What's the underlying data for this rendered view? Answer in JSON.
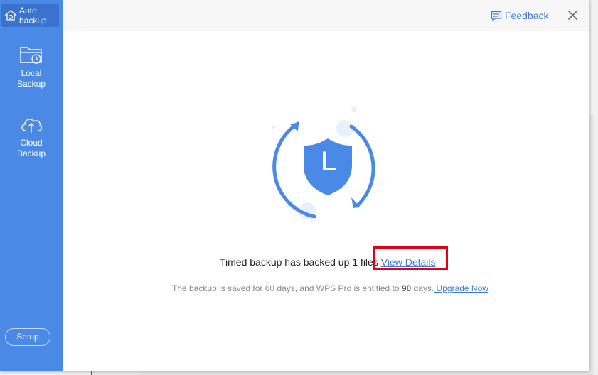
{
  "sidebar": {
    "active_item": {
      "label_line1": "Auto",
      "label_line2": "backup",
      "icon": "auto-backup-icon"
    },
    "items": [
      {
        "label_line1": "Local",
        "label_line2": "Backup",
        "icon": "local-backup-folder-icon"
      },
      {
        "label_line1": "Cloud",
        "label_line2": "Backup",
        "icon": "cloud-upload-icon"
      }
    ],
    "setup_label": "Setup"
  },
  "header": {
    "feedback_label": "Feedback",
    "close_icon": "close-icon"
  },
  "main": {
    "status_text": "Timed backup has backed up 1 files",
    "view_details_label": "View Details",
    "info_prefix": "The backup is saved for 60 days, and WPS Pro is entitled to ",
    "info_days": "90",
    "info_suffix": " days.",
    "upgrade_label": " Upgrade Now"
  },
  "colors": {
    "accent": "#4a8ae6",
    "link": "#3d7ad6",
    "highlight_box": "#e0001a"
  }
}
